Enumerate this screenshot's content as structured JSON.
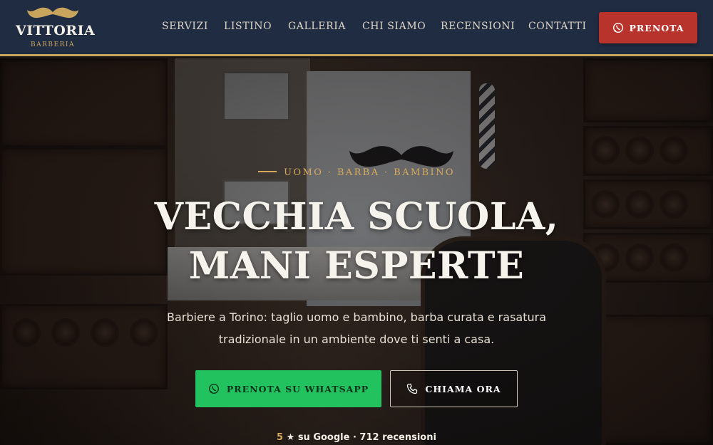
{
  "brand": {
    "name": "VITTORIA",
    "tagline": "BARBERIA",
    "logo_icon": "mustache-icon",
    "accent": "#c9a45c"
  },
  "nav": {
    "items": [
      {
        "label": "SERVIZI"
      },
      {
        "label": "LISTINO"
      },
      {
        "label": "GALLERIA"
      },
      {
        "label": "CHI SIAMO"
      },
      {
        "label": "RECENSIONI"
      },
      {
        "label": "CONTATTI"
      }
    ],
    "cta": {
      "label": "PRENOTA",
      "icon": "whatsapp-icon",
      "color": "#b8332b"
    }
  },
  "hero": {
    "eyebrow": "UOMO · BARBA · BAMBINO",
    "headline": [
      "VECCHIA SCUOLA,",
      "MANI ESPERTE"
    ],
    "lead": [
      "Barbiere a Torino: taglio uomo e bambino, barba curata e rasatura",
      "tradizionale in un ambiente dove ti senti a casa."
    ],
    "primary_button": {
      "label": "PRENOTA SU WHATSAPP",
      "icon": "whatsapp-icon",
      "color": "#22c35e"
    },
    "secondary_button": {
      "label": "CHIAMA ORA",
      "icon": "phone-icon"
    },
    "rating": {
      "score": "5",
      "star": "★",
      "text": "su Google · 712 recensioni"
    }
  }
}
